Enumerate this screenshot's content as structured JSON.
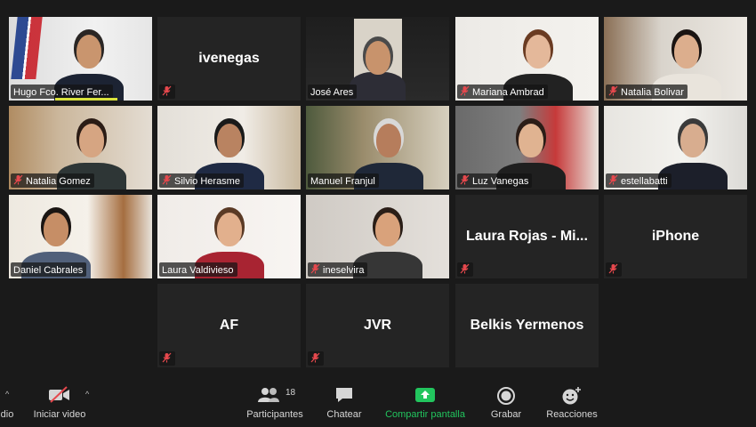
{
  "participants": [
    {
      "name": "Hugo Fco. River Fer...",
      "video": true,
      "muted": false
    },
    {
      "name": "ivenegas",
      "video": false,
      "muted": true
    },
    {
      "name": "José Ares",
      "video": true,
      "muted": false,
      "active": true
    },
    {
      "name": "Mariana Ambrad",
      "video": true,
      "muted": true
    },
    {
      "name": "Natalia Bolivar",
      "video": true,
      "muted": true
    },
    {
      "name": "Natalia Gomez",
      "video": true,
      "muted": true
    },
    {
      "name": "Silvio Herasme",
      "video": true,
      "muted": true
    },
    {
      "name": "Manuel Franjul",
      "video": true,
      "muted": false
    },
    {
      "name": "Luz Vanegas",
      "video": true,
      "muted": true
    },
    {
      "name": "estellabatti",
      "video": true,
      "muted": true
    },
    {
      "name": "Daniel Cabrales",
      "video": true,
      "muted": false
    },
    {
      "name": "Laura Valdivieso",
      "video": true,
      "muted": false
    },
    {
      "name": "ineselvira",
      "video": true,
      "muted": true
    },
    {
      "name": "Laura Rojas - Mi...",
      "video": false,
      "muted": true
    },
    {
      "name": "iPhone",
      "video": false,
      "muted": true
    },
    {
      "name": "AF",
      "video": false,
      "muted": true
    },
    {
      "name": "JVR",
      "video": false,
      "muted": true
    },
    {
      "name": "Belkis Yermenos",
      "video": false,
      "muted": false
    }
  ],
  "toolbar": {
    "audio_label_partial": "dio",
    "video_label": "Iniciar video",
    "participants_label": "Participantes",
    "participants_count": "18",
    "chat_label": "Chatear",
    "share_label": "Compartir pantalla",
    "record_label": "Grabar",
    "reactions_label": "Reacciones"
  },
  "colors": {
    "active_speaker": "#d8e23c",
    "share_green": "#22c55e",
    "muted_red": "#e5484d"
  }
}
